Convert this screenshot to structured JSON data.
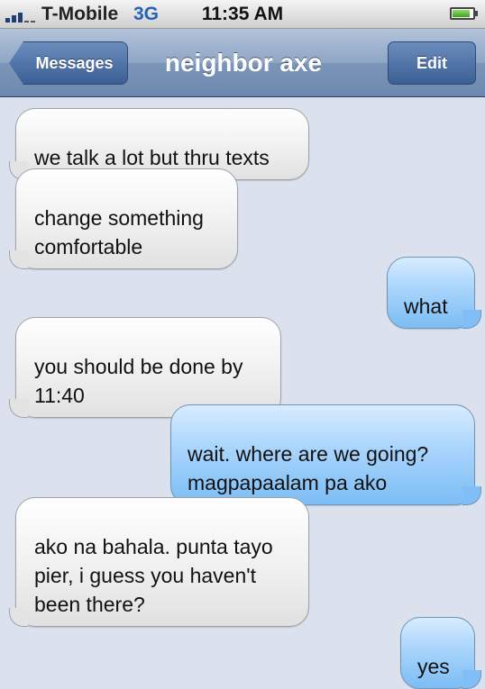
{
  "status_bar": {
    "carrier": "T-Mobile",
    "network": "3G",
    "time": "11:35 AM",
    "battery_level": 0.85,
    "signal_icon": "signal-bars-icon",
    "battery_icon": "battery-icon"
  },
  "nav": {
    "back_label": "Messages",
    "title": "neighbor axe",
    "edit_label": "Edit"
  },
  "colors": {
    "nav_bar": "#7c96b9",
    "sent_bubble": "#a8d4fb",
    "received_bubble": "#eeeeee",
    "background": "#dbe2ed"
  },
  "messages": [
    {
      "direction": "received",
      "text": "we talk a lot but thru texts"
    },
    {
      "direction": "received",
      "text": "change something\ncomfortable"
    },
    {
      "direction": "sent",
      "text": "what"
    },
    {
      "direction": "received",
      "text": "you should be done by\n11:40"
    },
    {
      "direction": "sent",
      "text": "wait. where are we going?\nmagpapaalam pa ako"
    },
    {
      "direction": "received",
      "text": "ako na bahala. punta tayo\npier, i guess you haven't\nbeen there?"
    },
    {
      "direction": "sent",
      "text": "yes"
    }
  ]
}
